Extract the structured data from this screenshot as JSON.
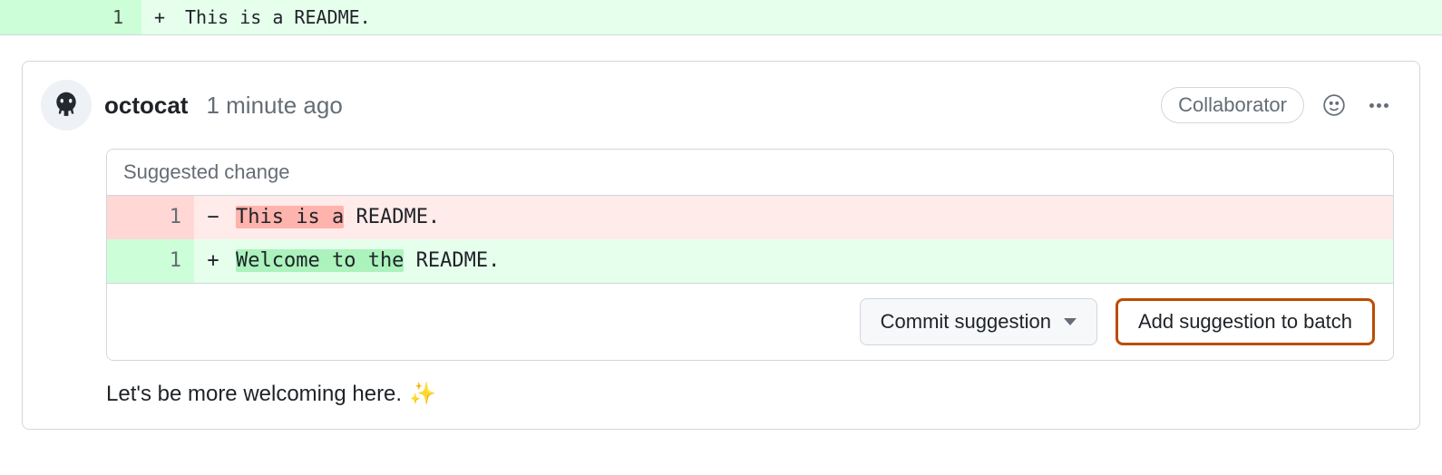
{
  "top_diff": {
    "line_number": "1",
    "marker": "+",
    "code": "This is a README."
  },
  "comment": {
    "author": "octocat",
    "timestamp": "1 minute ago",
    "badge": "Collaborator",
    "body_text": "Let's be more welcoming here.",
    "body_emoji": "✨"
  },
  "suggestion": {
    "title": "Suggested change",
    "deletion": {
      "line_number": "1",
      "marker": "−",
      "highlight": "This is a",
      "rest": " README."
    },
    "addition": {
      "line_number": "1",
      "marker": "+",
      "highlight": "Welcome to the",
      "rest": " README."
    },
    "commit_label": "Commit suggestion",
    "batch_label": "Add suggestion to batch"
  }
}
